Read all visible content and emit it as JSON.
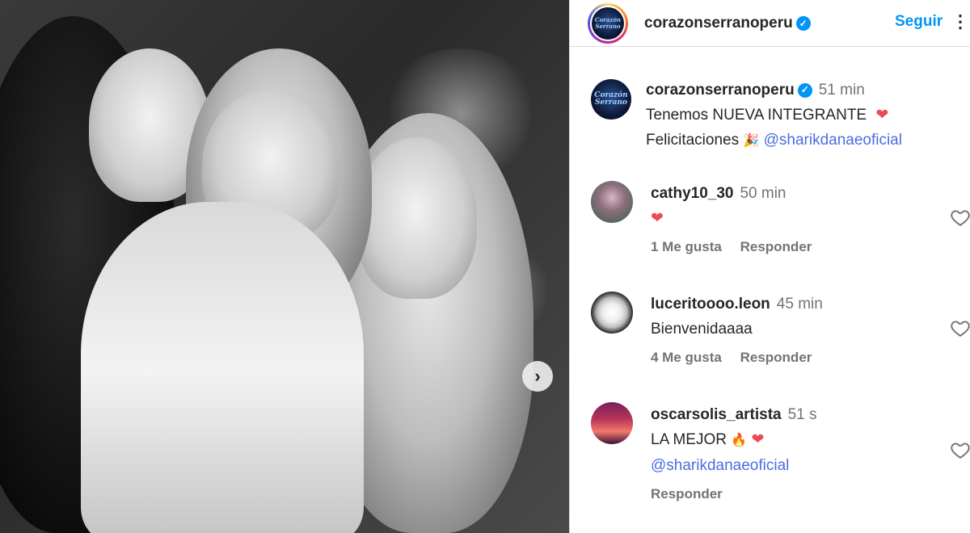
{
  "post": {
    "username": "corazonserranoperu",
    "follow_label": "Seguir",
    "more_label": "⋮",
    "logo_text": "Corazón Serrano"
  },
  "caption": {
    "username": "corazonserranoperu",
    "time": "51 min",
    "line1": "Tenemos NUEVA INTEGRANTE",
    "line1_emoji": "❤",
    "line2": "Felicitaciones",
    "line2_emoji": "🎉",
    "mention": "@sharikdanaeoficial"
  },
  "comments": [
    {
      "username": "cathy10_30",
      "time": "50 min",
      "text": "",
      "emoji": "❤",
      "likes": "1 Me gusta",
      "reply": "Responder"
    },
    {
      "username": "luceritoooo.leon",
      "time": "45 min",
      "text": "Bienvenidaaaa",
      "likes": "4 Me gusta",
      "reply": "Responder"
    },
    {
      "username": "oscarsolis_artista",
      "time": "51 s",
      "text": "LA MEJOR",
      "emoji1": "🔥",
      "emoji2": "❤",
      "mention": "@sharikdanaeoficial",
      "reply": "Responder"
    }
  ],
  "icons": {
    "verified": "✓",
    "next": "›"
  },
  "colors": {
    "accent": "#0095f6",
    "mention": "#4a6ee0",
    "heart": "#ed4956",
    "muted": "#737373"
  }
}
